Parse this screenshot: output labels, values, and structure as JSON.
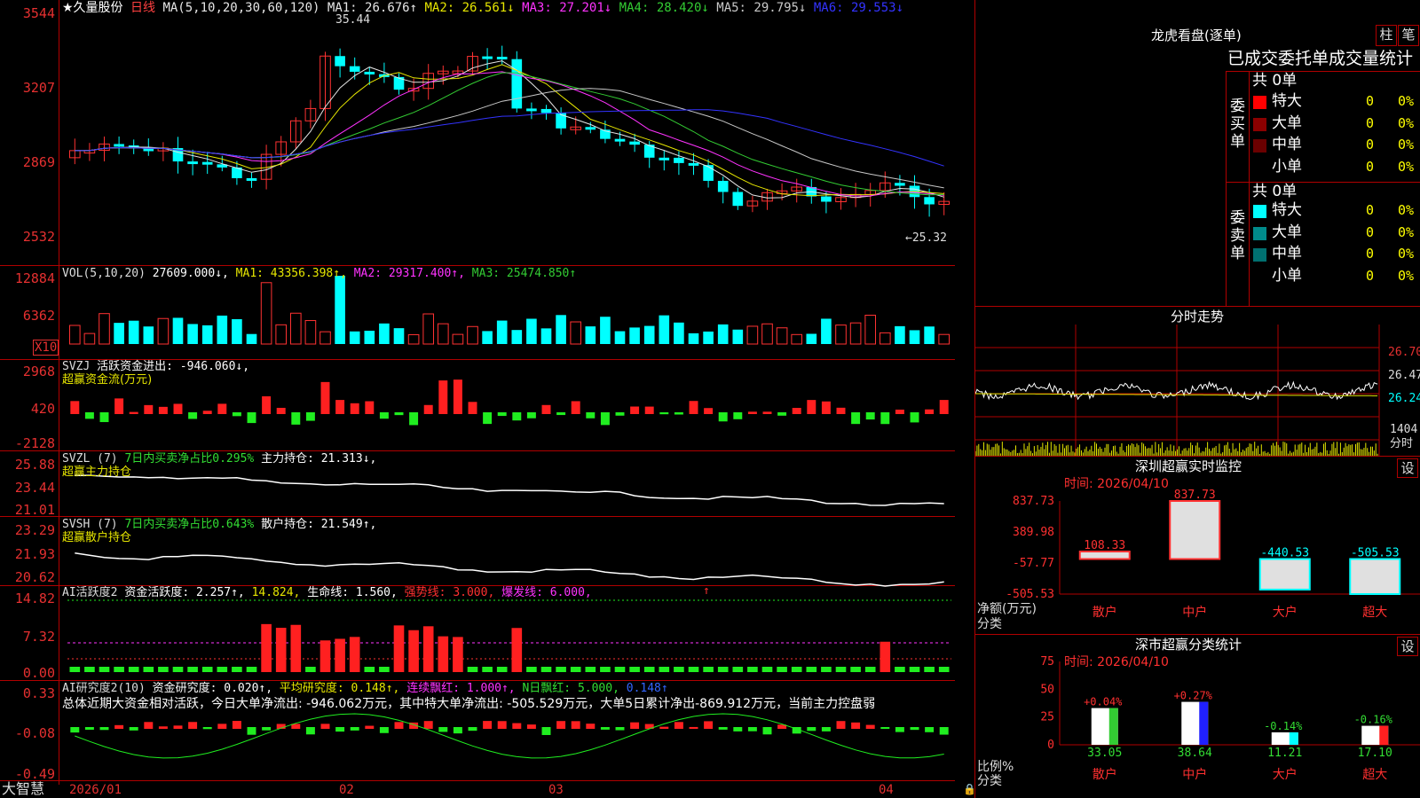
{
  "header": {
    "stock_name": "★久量股份",
    "period": "日线",
    "ma_label": "MA(5,10,20,30,60,120)",
    "ma": [
      {
        "label": "MA1: 26.676↑",
        "color": "#e6e6e6"
      },
      {
        "label": "MA2: 26.561↓",
        "color": "#e6e600"
      },
      {
        "label": "MA3: 27.201↓",
        "color": "#ff33ff"
      },
      {
        "label": "MA4: 28.420↓",
        "color": "#33cc33"
      },
      {
        "label": "MA5: 29.795↓",
        "color": "#c8c8c8"
      },
      {
        "label": "MA6: 29.553↓",
        "color": "#3333ff"
      }
    ],
    "high_marker": "35.44",
    "low_marker": "←25.32"
  },
  "price_axis": [
    "3544",
    "3207",
    "2869",
    "2532"
  ],
  "vol_panel": {
    "axis": [
      "12884",
      "6362"
    ],
    "unit": "X10",
    "label": "VOL(5,10,20)",
    "value": "27609.000↓,",
    "ma1": "MA1: 43356.398↑,",
    "ma2": "MA2: 29317.400↑,",
    "ma3": "MA3: 25474.850↑"
  },
  "svzj_panel": {
    "axis": [
      "2968",
      "420",
      "-2128"
    ],
    "label": "SVZJ",
    "desc": "活跃资金进出: -946.060↓,",
    "sub": "超赢资金流(万元)"
  },
  "svzl_panel": {
    "axis": [
      "25.88",
      "23.44",
      "21.01"
    ],
    "label": "SVZL (7)",
    "desc": "7日内买卖净占比0.295%",
    "hold": "主力持仓: 21.313↓,",
    "sub": "超赢主力持仓"
  },
  "svsh_panel": {
    "axis": [
      "23.29",
      "21.93",
      "20.62"
    ],
    "label": "SVSH (7)",
    "desc": "7日内买卖净占比0.643%",
    "hold": "散户持仓: 21.549↑,",
    "sub": "超赢散户持仓"
  },
  "ai_active_panel": {
    "axis": [
      "14.82",
      "7.32",
      "0.00"
    ],
    "label": "AI活跃度2",
    "value": "资金活跃度: 2.257↑,",
    "v2": "14.824,",
    "life": "生命线: 1.560,",
    "strong": "强势线: 3.000,",
    "burst": "爆发线: 6.000,",
    "arrow": "↑"
  },
  "ai_research_panel": {
    "axis": [
      "0.33",
      "-0.08",
      "-0.49"
    ],
    "label": "AI研究度2(10)",
    "value": "资金研究度: 0.020↑,",
    "avg": "平均研究度: 0.148↑,",
    "streak": "连续飘红: 1.000↑,",
    "nday": "N日飘红: 5.000,",
    "tail": "0.148↑",
    "summary": "总体近期大资金相对活跃，今日大单净流出: -946.062万元，其中特大单净流出: -505.529万元，大单5日累计净出-869.912万元，当前主力控盘弱"
  },
  "footer": {
    "brand": "大智慧",
    "x_labels": [
      "2026/01",
      "02",
      "03",
      "04"
    ]
  },
  "right_top": {
    "title": "龙虎看盘(逐单)",
    "btn1": "柱",
    "btn2": "笔",
    "subtitle": "已成交委托单成交量统计",
    "buy": {
      "side_label": "委买单",
      "total": "共 0单",
      "rows": [
        {
          "name": "特大",
          "count": "0",
          "pct": "0%",
          "color": "#ff0000"
        },
        {
          "name": "大单",
          "count": "0",
          "pct": "0%",
          "color": "#8b0000"
        },
        {
          "name": "中单",
          "count": "0",
          "pct": "0%",
          "color": "#6b0000"
        },
        {
          "name": "小单",
          "count": "0",
          "pct": "0%",
          "color": ""
        }
      ]
    },
    "sell": {
      "side_label": "委卖单",
      "total": "共 0单",
      "rows": [
        {
          "name": "特大",
          "count": "0",
          "pct": "0%",
          "color": "#00ffff"
        },
        {
          "name": "大单",
          "count": "0",
          "pct": "0%",
          "color": "#008b8b"
        },
        {
          "name": "中单",
          "count": "0",
          "pct": "0%",
          "color": "#007070"
        },
        {
          "name": "小单",
          "count": "0",
          "pct": "0%",
          "color": ""
        }
      ]
    }
  },
  "intraday": {
    "title": "分时走势",
    "price_labels": [
      "26.70",
      "26.47",
      "26.24"
    ],
    "vol_label": "1404",
    "vol_unit": "分时"
  },
  "monitor": {
    "title": "深圳超赢实时监控",
    "btn": "设",
    "time": "时间: 2026/04/10",
    "axis": [
      "837.73",
      "389.98",
      "-57.77",
      "-505.53"
    ],
    "y_title": "净额(万元)",
    "x_title": "分类",
    "categories": [
      "散户",
      "中户",
      "大户",
      "超大"
    ],
    "value_labels": [
      "108.33",
      "837.73",
      "-440.53",
      "-505.53"
    ]
  },
  "classify": {
    "title": "深市超赢分类统计",
    "btn": "设",
    "time": "时间: 2026/04/10",
    "axis": [
      "75",
      "50",
      "25",
      "0"
    ],
    "y_title": "比例%",
    "x_title": "分类",
    "categories": [
      "散户",
      "中户",
      "大户",
      "超大"
    ],
    "pct_labels": [
      "+0.04%",
      "+0.27%",
      "-0.14%",
      "-0.16%"
    ],
    "value_labels": [
      "33.05",
      "38.64",
      "11.21",
      "17.10"
    ]
  },
  "chart_data": [
    {
      "type": "bar",
      "title": "深圳超赢实时监控",
      "ylabel": "净额(万元)",
      "categories": [
        "散户",
        "中户",
        "大户",
        "超大"
      ],
      "values": [
        108.33,
        837.73,
        -440.53,
        -505.53
      ],
      "ylim": [
        -505.53,
        837.73
      ]
    },
    {
      "type": "bar",
      "title": "深市超赢分类统计",
      "ylabel": "比例%",
      "categories": [
        "散户",
        "中户",
        "大户",
        "超大"
      ],
      "values": [
        33.05,
        38.64,
        11.21,
        17.1
      ],
      "ylim": [
        0,
        75
      ]
    }
  ]
}
